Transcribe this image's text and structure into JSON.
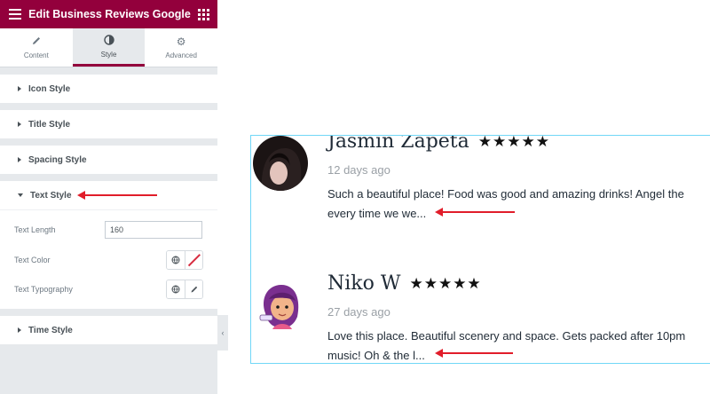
{
  "panel": {
    "title": "Edit Business Reviews Google",
    "tabs": [
      {
        "label": "Content",
        "icon": "pencil-icon"
      },
      {
        "label": "Style",
        "icon": "contrast-icon"
      },
      {
        "label": "Advanced",
        "icon": "gear-icon"
      }
    ],
    "active_tab": "Style",
    "accent": "#93003c",
    "sections": {
      "icon_style": "Icon Style",
      "title_style": "Title Style",
      "spacing_style": "Spacing Style",
      "text_style": "Text Style",
      "time_style": "Time Style"
    },
    "controls": {
      "text_length_label": "Text Length",
      "text_length_value": "160",
      "text_color_label": "Text Color",
      "text_typography_label": "Text Typography"
    }
  },
  "reviews": [
    {
      "name": "Jasmin Zapeta",
      "stars": "★★★★★",
      "ago": "12 days ago",
      "text_line1": "Such a beautiful place! Food was good and amazing drinks! Angel the",
      "text_line2": "every time we we..."
    },
    {
      "name": "Niko W",
      "stars": "★★★★★",
      "ago": "27 days ago",
      "text_line1": "Love this place. Beautiful scenery and space. Gets packed after 10pm",
      "text_line2": "music! Oh & the l..."
    }
  ],
  "annotation_color": "#e11d2a",
  "preview_border_color": "#71d7f7"
}
